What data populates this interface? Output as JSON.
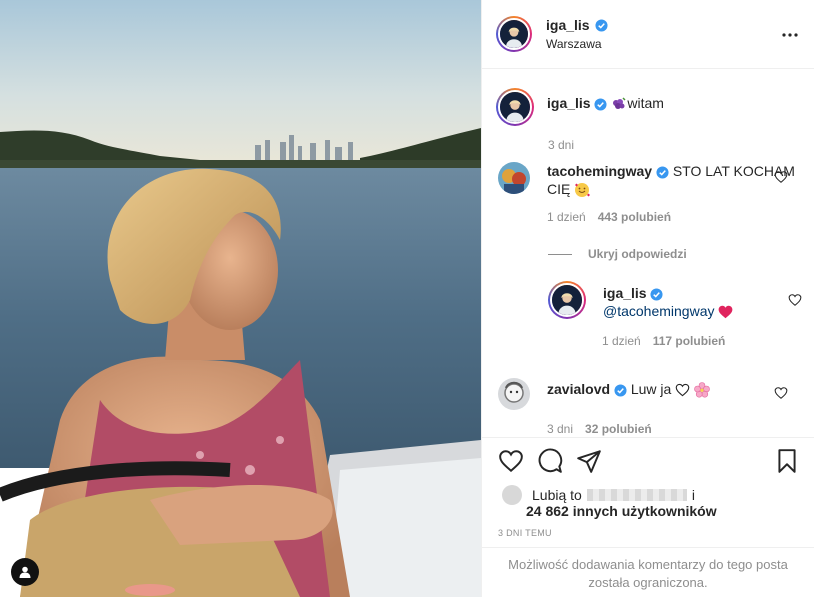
{
  "post": {
    "author": "iga_lis",
    "location": "Warszawa",
    "more_icon": "more-horizontal-icon"
  },
  "caption": {
    "author": "iga_lis",
    "text": "witam",
    "time": "3 dni"
  },
  "comments": [
    {
      "author": "tacohemingway",
      "text": "STO LAT KOCHAM CIĘ",
      "time": "1 dzień",
      "likes": "443 polubień"
    },
    {
      "author": "iga_lis",
      "mention": "@tacohemingway",
      "time": "1 dzień",
      "likes": "117 polubień"
    },
    {
      "author": "zavialovd",
      "text": "Luw ja",
      "time": "3 dni",
      "likes": "32 polubień"
    }
  ],
  "hide_replies": "Ukryj odpowiedzi",
  "likes": {
    "prefix": "Lubią to",
    "suffix": "i",
    "others": "24 862 innych użytkowników"
  },
  "timestamp": "3 DNI TEMU",
  "restricted_notice": "Możliwość dodawania komentarzy do tego posta została ograniczona.",
  "colors": {
    "verified": "#3897f0",
    "meta": "#8e8e8e",
    "heart": "#ed4956"
  }
}
